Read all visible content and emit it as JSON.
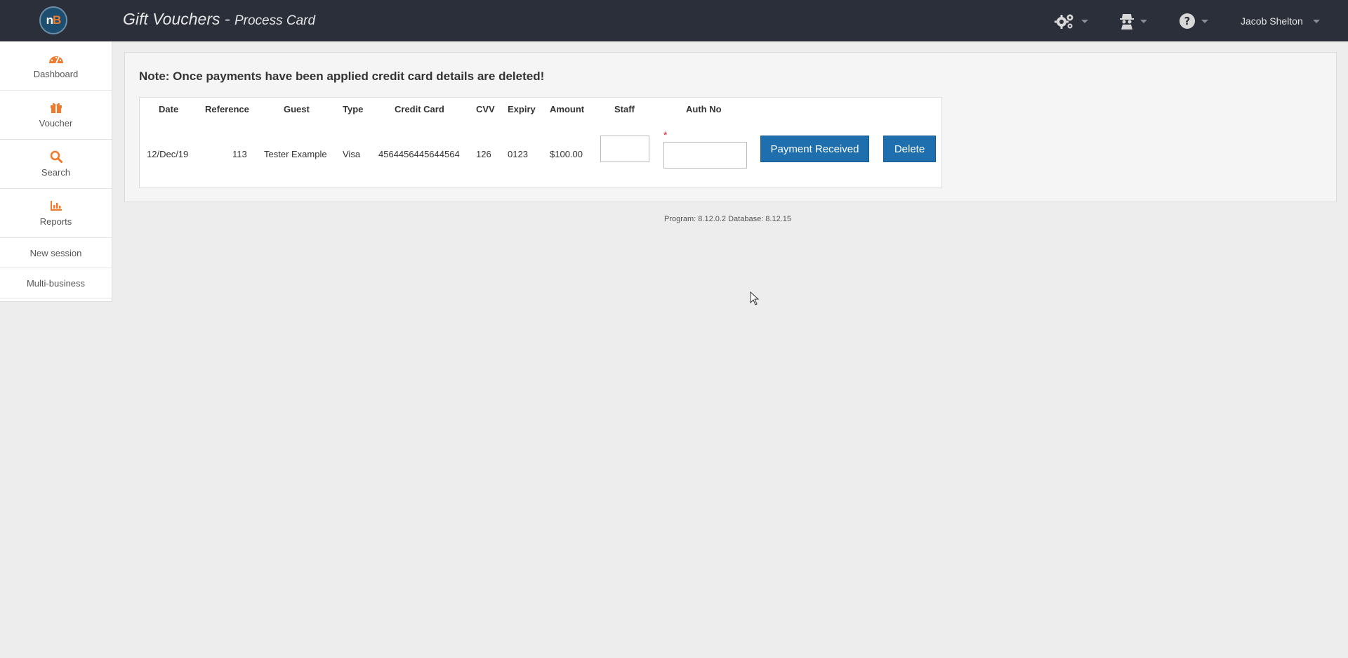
{
  "header": {
    "logo": {
      "left": "n",
      "right": "B"
    },
    "title": "Gift Vouchers",
    "separator": "-",
    "subtitle": "Process Card",
    "icons": [
      "gears-icon",
      "spy-icon",
      "help-icon"
    ],
    "user_name": "Jacob Shelton"
  },
  "sidebar": {
    "items": [
      {
        "label": "Dashboard",
        "icon": "dashboard-icon"
      },
      {
        "label": "Voucher",
        "icon": "gift-icon"
      },
      {
        "label": "Search",
        "icon": "search-icon"
      },
      {
        "label": "Reports",
        "icon": "bar-chart-icon"
      },
      {
        "label": "New session"
      },
      {
        "label": "Multi-business"
      }
    ]
  },
  "main": {
    "note": "Note: Once payments have been applied credit card details are deleted!",
    "table": {
      "headers": {
        "date": "Date",
        "reference": "Reference",
        "guest": "Guest",
        "type": "Type",
        "credit_card": "Credit Card",
        "cvv": "CVV",
        "expiry": "Expiry",
        "amount": "Amount",
        "staff": "Staff",
        "auth_no": "Auth No"
      },
      "row": {
        "date": "12/Dec/19",
        "reference": "113",
        "guest": "Tester Example",
        "type": "Visa",
        "credit_card": "4564456445644564",
        "cvv": "126",
        "expiry": "0123",
        "amount": "$100.00",
        "staff_value": "",
        "auth_no_value": "",
        "required_marker": "*"
      }
    },
    "buttons": {
      "payment_received": "Payment Received",
      "delete": "Delete"
    }
  },
  "footer": {
    "version": "Program: 8.12.0.2 Database: 8.12.15"
  },
  "colors": {
    "topbar": "#2b2f3a",
    "accent_orange": "#f07a2a",
    "button_blue": "#1f6fae",
    "required_red": "#d9262b"
  }
}
